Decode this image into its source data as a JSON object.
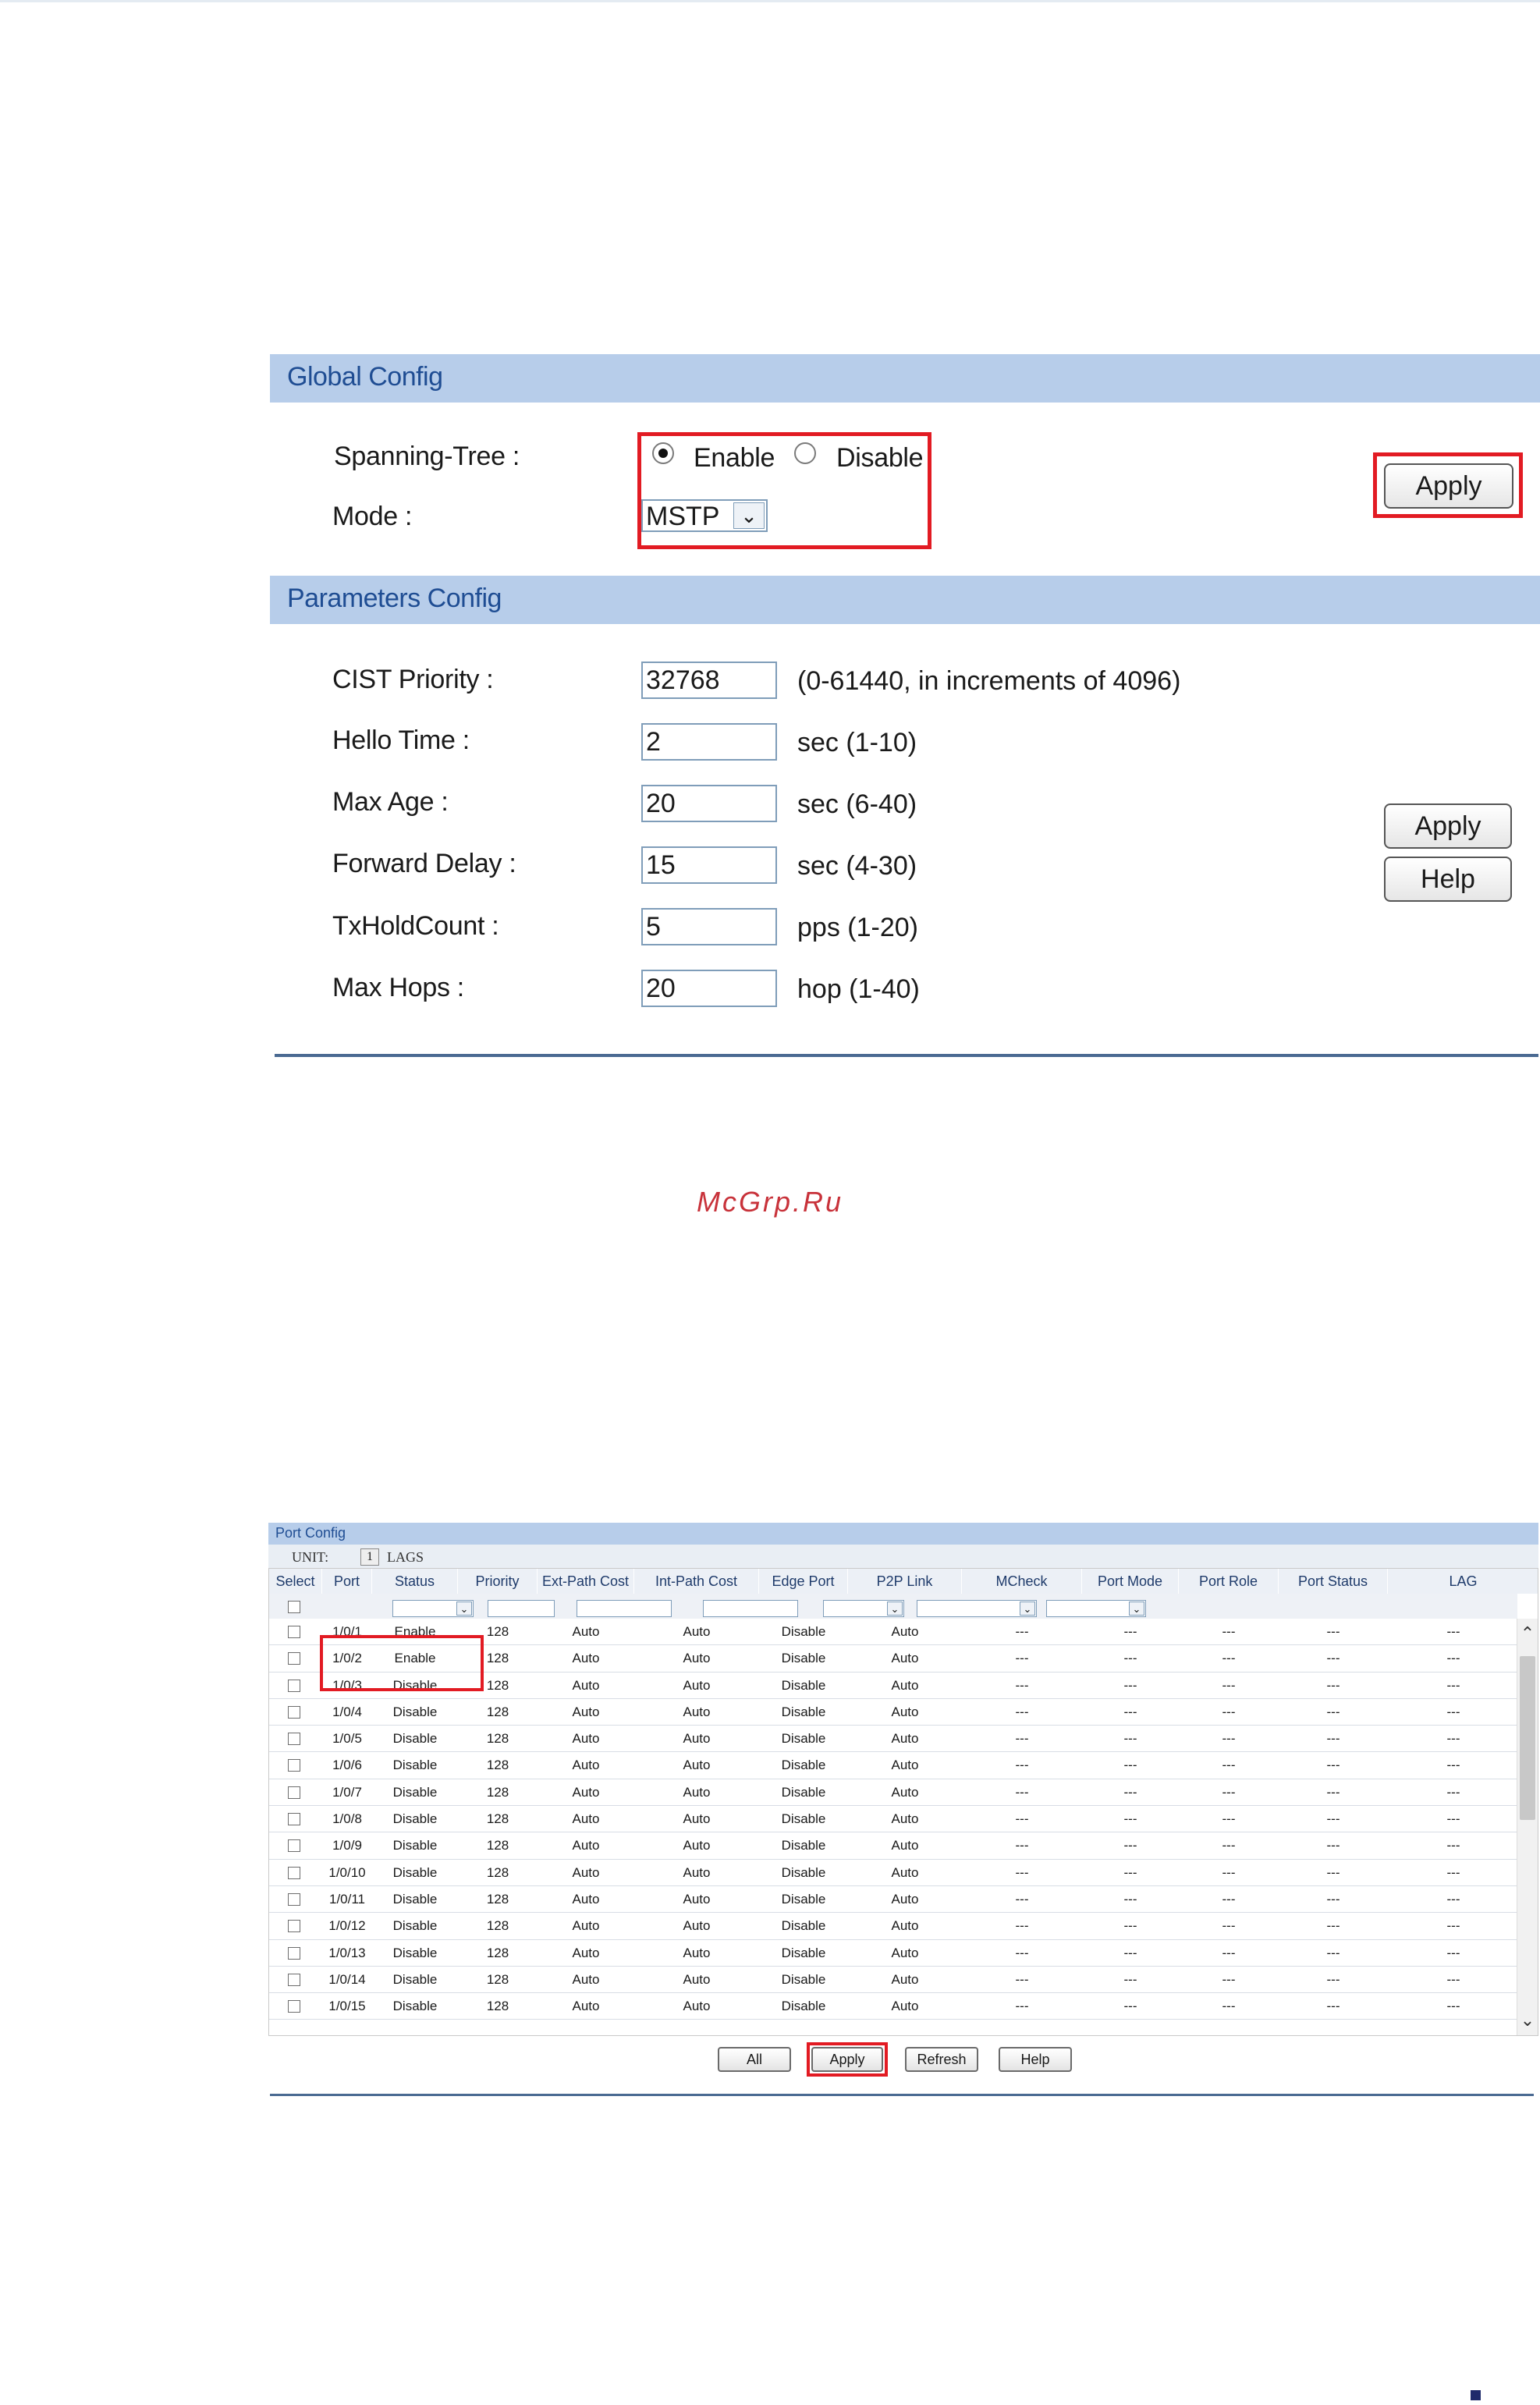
{
  "global": {
    "header": "Global Config",
    "spanning_tree_label": "Spanning-Tree :",
    "enable_label": "Enable",
    "disable_label": "Disable",
    "spanning_tree_value": "Enable",
    "mode_label": "Mode :",
    "mode_value": "MSTP",
    "apply_label": "Apply"
  },
  "params": {
    "header": "Parameters Config",
    "fields": [
      {
        "label": "CIST Priority :",
        "value": "32768",
        "unit": "(0-61440, in increments of 4096)"
      },
      {
        "label": "Hello Time :",
        "value": "2",
        "unit": "sec (1-10)"
      },
      {
        "label": "Max Age :",
        "value": "20",
        "unit": "sec (6-40)"
      },
      {
        "label": "Forward Delay :",
        "value": "15",
        "unit": "sec (4-30)"
      },
      {
        "label": "TxHoldCount :",
        "value": "5",
        "unit": "pps (1-20)"
      },
      {
        "label": "Max Hops :",
        "value": "20",
        "unit": "hop (1-40)"
      }
    ],
    "apply_label": "Apply",
    "help_label": "Help"
  },
  "watermark": "McGrp.Ru",
  "port_config": {
    "header": "Port Config",
    "unit_label": "UNIT:",
    "unit_value": "1",
    "lags_label": "LAGS",
    "columns": [
      "Select",
      "Port",
      "Status",
      "Priority",
      "Ext-Path Cost",
      "Int-Path Cost",
      "Edge Port",
      "P2P Link",
      "MCheck",
      "Port Mode",
      "Port Role",
      "Port Status",
      "LAG"
    ],
    "rows": [
      [
        "1/0/1",
        "Enable",
        "128",
        "Auto",
        "Auto",
        "Disable",
        "Auto",
        "---",
        "---",
        "---",
        "---",
        "---"
      ],
      [
        "1/0/2",
        "Enable",
        "128",
        "Auto",
        "Auto",
        "Disable",
        "Auto",
        "---",
        "---",
        "---",
        "---",
        "---"
      ],
      [
        "1/0/3",
        "Disable",
        "128",
        "Auto",
        "Auto",
        "Disable",
        "Auto",
        "---",
        "---",
        "---",
        "---",
        "---"
      ],
      [
        "1/0/4",
        "Disable",
        "128",
        "Auto",
        "Auto",
        "Disable",
        "Auto",
        "---",
        "---",
        "---",
        "---",
        "---"
      ],
      [
        "1/0/5",
        "Disable",
        "128",
        "Auto",
        "Auto",
        "Disable",
        "Auto",
        "---",
        "---",
        "---",
        "---",
        "---"
      ],
      [
        "1/0/6",
        "Disable",
        "128",
        "Auto",
        "Auto",
        "Disable",
        "Auto",
        "---",
        "---",
        "---",
        "---",
        "---"
      ],
      [
        "1/0/7",
        "Disable",
        "128",
        "Auto",
        "Auto",
        "Disable",
        "Auto",
        "---",
        "---",
        "---",
        "---",
        "---"
      ],
      [
        "1/0/8",
        "Disable",
        "128",
        "Auto",
        "Auto",
        "Disable",
        "Auto",
        "---",
        "---",
        "---",
        "---",
        "---"
      ],
      [
        "1/0/9",
        "Disable",
        "128",
        "Auto",
        "Auto",
        "Disable",
        "Auto",
        "---",
        "---",
        "---",
        "---",
        "---"
      ],
      [
        "1/0/10",
        "Disable",
        "128",
        "Auto",
        "Auto",
        "Disable",
        "Auto",
        "---",
        "---",
        "---",
        "---",
        "---"
      ],
      [
        "1/0/11",
        "Disable",
        "128",
        "Auto",
        "Auto",
        "Disable",
        "Auto",
        "---",
        "---",
        "---",
        "---",
        "---"
      ],
      [
        "1/0/12",
        "Disable",
        "128",
        "Auto",
        "Auto",
        "Disable",
        "Auto",
        "---",
        "---",
        "---",
        "---",
        "---"
      ],
      [
        "1/0/13",
        "Disable",
        "128",
        "Auto",
        "Auto",
        "Disable",
        "Auto",
        "---",
        "---",
        "---",
        "---",
        "---"
      ],
      [
        "1/0/14",
        "Disable",
        "128",
        "Auto",
        "Auto",
        "Disable",
        "Auto",
        "---",
        "---",
        "---",
        "---",
        "---"
      ],
      [
        "1/0/15",
        "Disable",
        "128",
        "Auto",
        "Auto",
        "Disable",
        "Auto",
        "---",
        "---",
        "---",
        "---",
        "---"
      ]
    ],
    "buttons": {
      "all": "All",
      "apply": "Apply",
      "refresh": "Refresh",
      "help": "Help"
    }
  },
  "icons": {
    "dropdown": "chevron-down-icon",
    "scroll_up": "chevron-up-icon",
    "scroll_down": "chevron-down-icon"
  },
  "colors": {
    "section_bar": "#b7cdea",
    "section_title": "#1f4d93",
    "highlight": "#e21b23",
    "separator": "#4a6a92"
  }
}
